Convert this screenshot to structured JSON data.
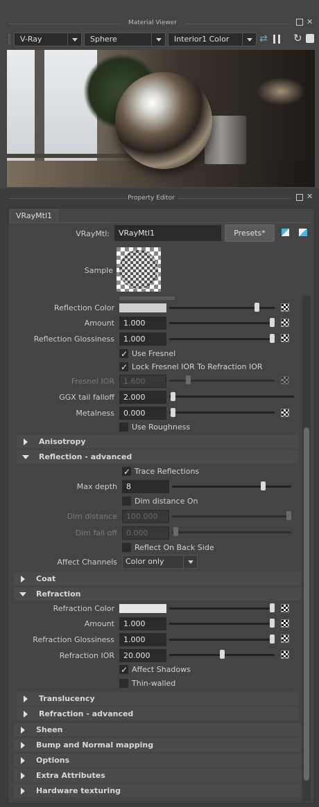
{
  "material_viewer": {
    "title": "Material Viewer",
    "renderer": "V-Ray",
    "shape": "Sphere",
    "environment": "Interior1 Color"
  },
  "property_editor": {
    "title": "Property Editor",
    "tab": "VRayMtl1",
    "vraymtl_label": "VRayMtl:",
    "vraymtl_value": "VRayMtl1",
    "presets": "Presets*",
    "sample_label": "Sample"
  },
  "reflection": {
    "color_label": "Reflection Color",
    "color": "#cfcfcf",
    "amount_label": "Amount",
    "amount": "1.000",
    "glossiness_label": "Reflection Glossiness",
    "glossiness": "1.000",
    "use_fresnel": "Use Fresnel",
    "lock_fresnel": "Lock Fresnel IOR To Refraction IOR",
    "fresnel_ior_label": "Fresnel IOR",
    "fresnel_ior": "1.600",
    "ggx_label": "GGX tail falloff",
    "ggx": "2.000",
    "metalness_label": "Metalness",
    "metalness": "0.000",
    "use_roughness": "Use Roughness"
  },
  "sections": {
    "anisotropy": "Anisotropy",
    "reflection_advanced": "Reflection - advanced",
    "coat": "Coat",
    "refraction": "Refraction",
    "translucency": "Translucency",
    "refraction_advanced": "Refraction - advanced",
    "sheen": "Sheen",
    "bump": "Bump and Normal mapping",
    "options": "Options",
    "extra": "Extra Attributes",
    "hardware": "Hardware texturing"
  },
  "reflection_advanced": {
    "trace_reflections": "Trace Reflections",
    "max_depth_label": "Max depth",
    "max_depth": "8",
    "dim_distance_on": "Dim distance On",
    "dim_distance_label": "Dim distance",
    "dim_distance": "100.000",
    "dim_falloff_label": "Dim fall off",
    "dim_falloff": "0.000",
    "reflect_back": "Reflect On Back Side",
    "affect_channels_label": "Affect Channels",
    "affect_channels": "Color only"
  },
  "refraction": {
    "color_label": "Refraction Color",
    "color": "#e6e6e6",
    "amount_label": "Amount",
    "amount": "1.000",
    "glossiness_label": "Refraction Glossiness",
    "glossiness": "1.000",
    "ior_label": "Refraction IOR",
    "ior": "20.000",
    "affect_shadows": "Affect Shadows",
    "thin_walled": "Thin-walled"
  }
}
